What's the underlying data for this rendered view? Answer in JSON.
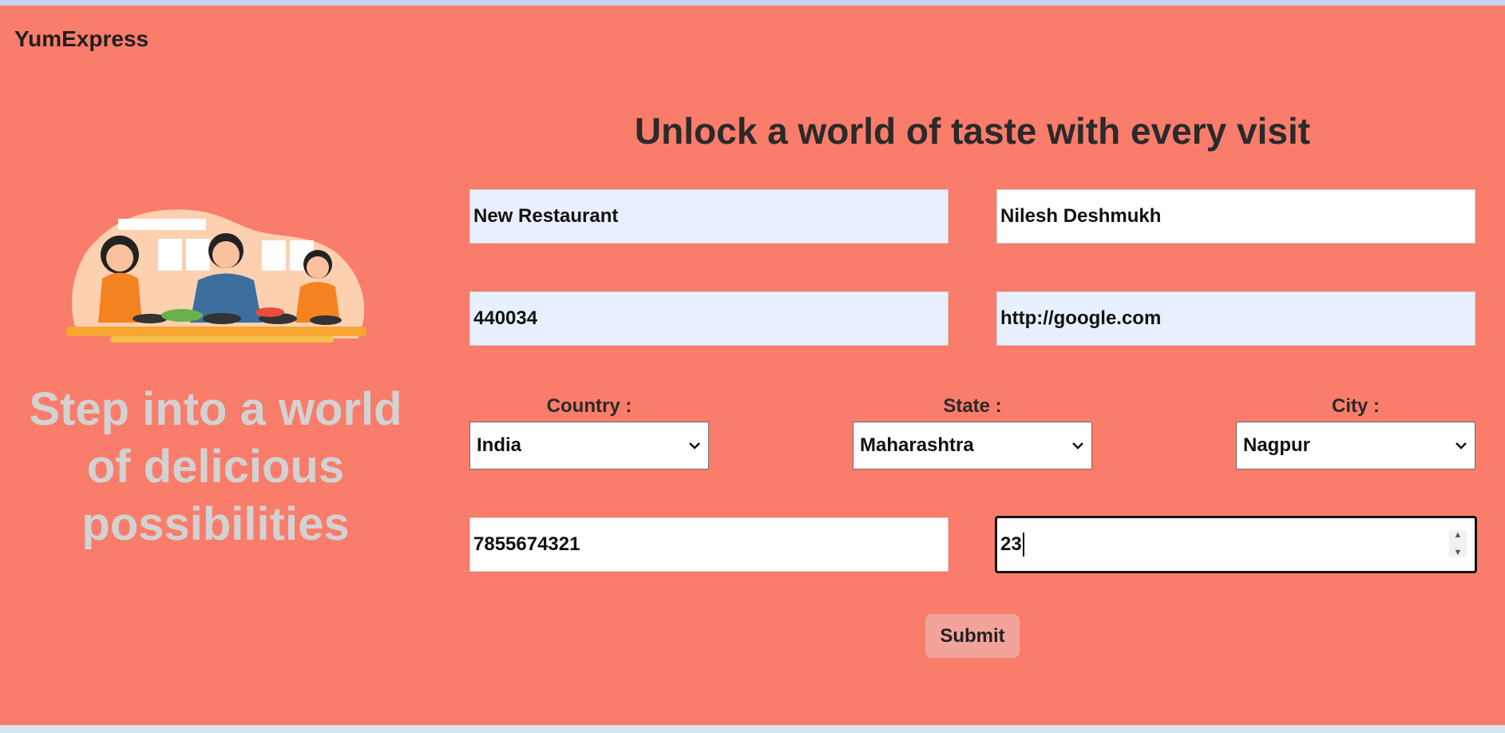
{
  "brand": {
    "name": "YumExpress"
  },
  "hero": {
    "tagline": "Step into a world of delicious possibilities",
    "illustration": "people-dining-illustration"
  },
  "form": {
    "heading": "Unlock a world of taste with every visit",
    "restaurant_name": "New Restaurant",
    "owner_name": "Nilesh  Deshmukh",
    "pincode": "440034",
    "website": "http://google.com",
    "country": {
      "label": "Country :",
      "value": "India"
    },
    "state": {
      "label": "State :",
      "value": "Maharashtra"
    },
    "city": {
      "label": "City :",
      "value": "Nagpur"
    },
    "phone": "7855674321",
    "number_value": "23",
    "submit_label": "Submit"
  },
  "colors": {
    "page_bg": "#fa7c6a",
    "autofill_bg": "#e8f0fe",
    "submit_bg": "#f2a49b",
    "tagline": "#d2d2d2"
  }
}
